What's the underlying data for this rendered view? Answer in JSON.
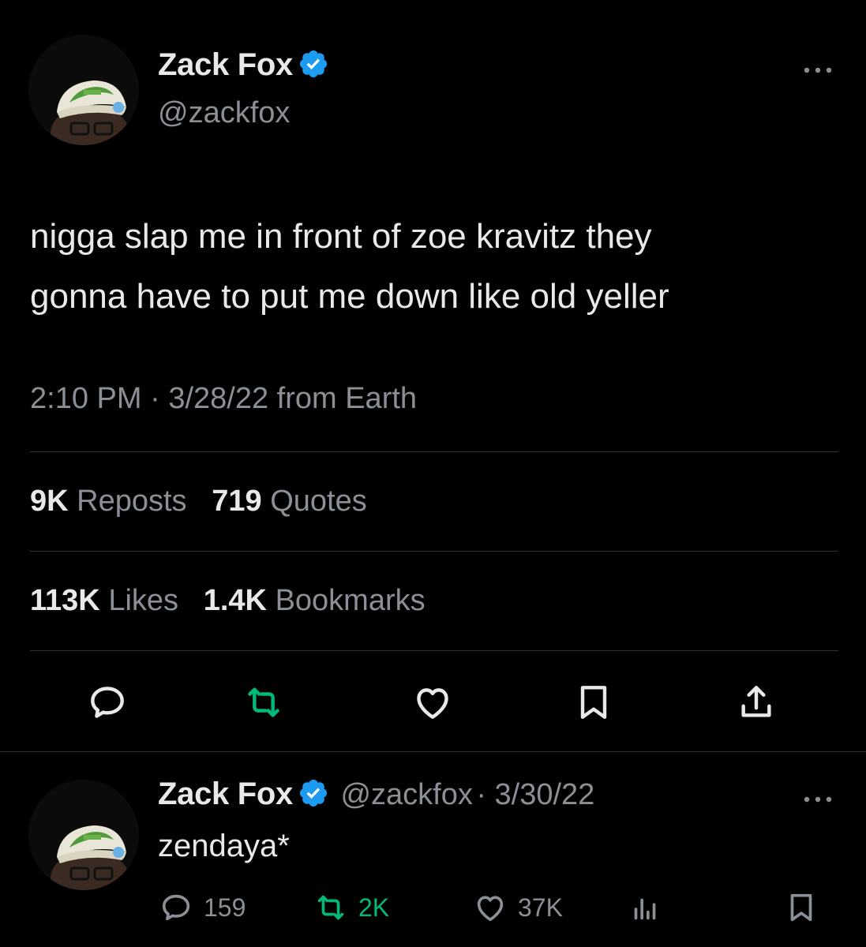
{
  "tweet": {
    "author": {
      "name": "Zack Fox",
      "handle": "@zackfox",
      "verified": true
    },
    "text_lines": [
      "nigga slap me in front of zoe kravitz they",
      "gonna have to put me down like old yeller"
    ],
    "time": "2:10 PM",
    "separator": "·",
    "date": "3/28/22 from Earth",
    "stats": {
      "reposts_count": "9K",
      "reposts_label": "Reposts",
      "quotes_count": "719",
      "quotes_label": "Quotes",
      "likes_count": "113K",
      "likes_label": "Likes",
      "bookmarks_count": "1.4K",
      "bookmarks_label": "Bookmarks"
    },
    "actions": [
      "reply-icon",
      "repost-icon",
      "like-icon",
      "bookmark-icon",
      "share-icon"
    ]
  },
  "reply": {
    "author": {
      "name": "Zack Fox",
      "handle": "@zackfox",
      "verified": true
    },
    "date": "· 3/30/22",
    "text": "zendaya*",
    "counts": {
      "replies": "159",
      "reposts": "2K",
      "likes": "37K"
    },
    "actions": [
      "reply-icon",
      "repost-icon",
      "like-icon",
      "views-icon",
      "bookmark-icon"
    ]
  },
  "colors": {
    "background": "#000000",
    "text": "#e7e9ea",
    "muted": "#8b9096",
    "verified": "#1d9bf0",
    "repost_active": "#00ba7c",
    "divider": "#2f3336"
  }
}
